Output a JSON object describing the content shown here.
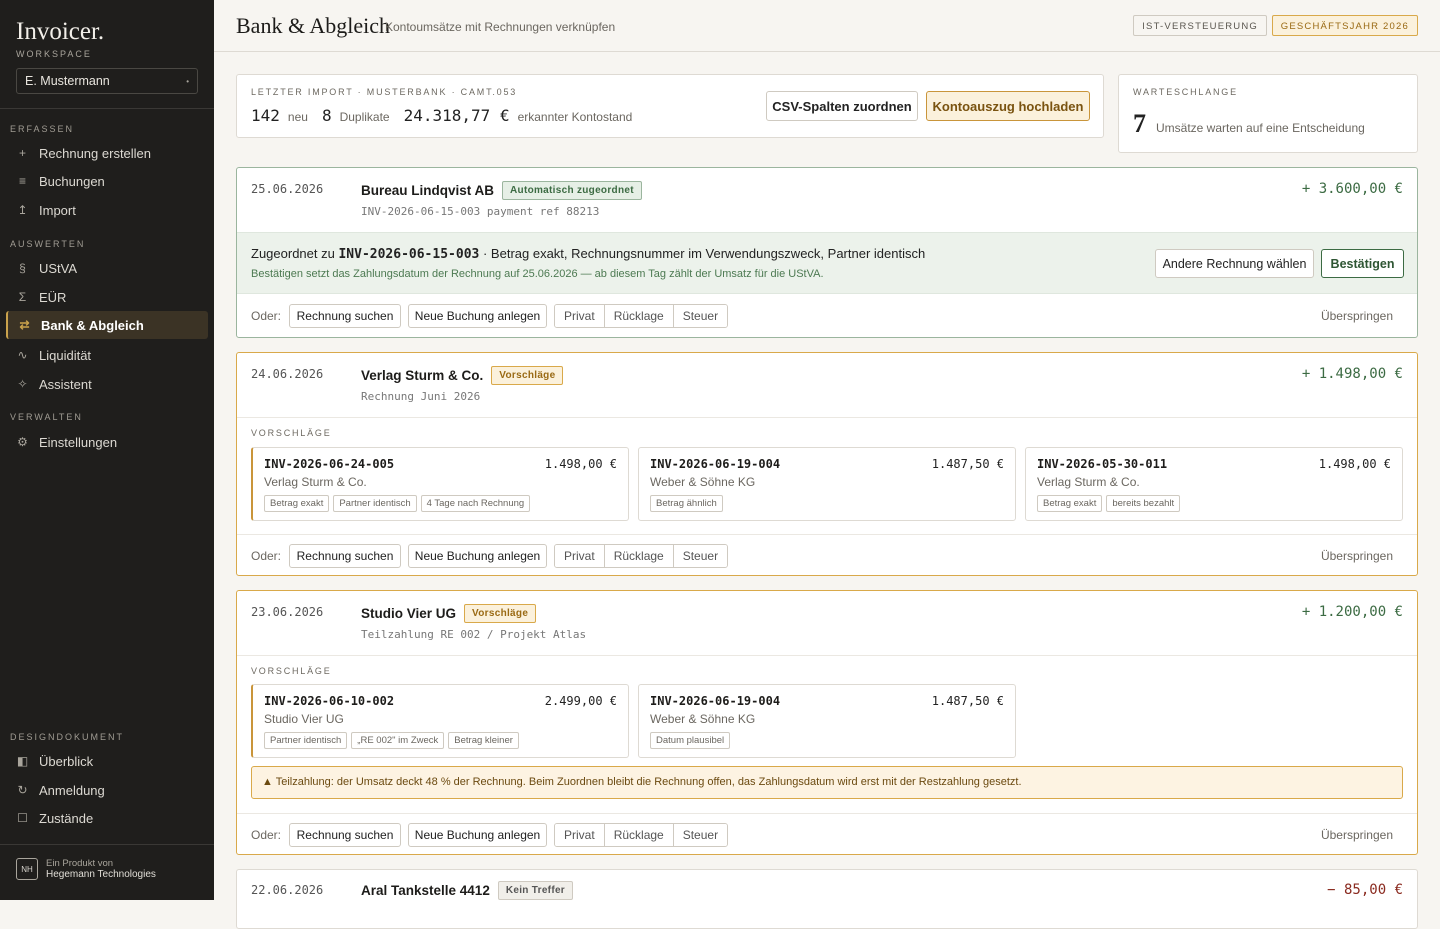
{
  "sidebar": {
    "logo": "Invoicer.",
    "workspace_label": "WORKSPACE",
    "user": "E. Mustermann",
    "sections": [
      {
        "label": "ERFASSEN"
      },
      {
        "label": "AUSWERTEN"
      },
      {
        "label": "VERWALTEN"
      },
      {
        "label": "DESIGNDOKUMENT"
      }
    ],
    "items": [
      {
        "label": "Rechnung erstellen",
        "icon": "plus-icon",
        "glyph": "+"
      },
      {
        "label": "Buchungen",
        "icon": "list-icon",
        "glyph": "≡"
      },
      {
        "label": "Import",
        "icon": "import-icon",
        "glyph": "↥"
      },
      {
        "label": "UStVA",
        "icon": "paragraph-icon",
        "glyph": "§"
      },
      {
        "label": "EÜR",
        "icon": "sigma-icon",
        "glyph": "Σ"
      },
      {
        "label": "Bank & Abgleich",
        "icon": "swap-icon",
        "glyph": "⇄"
      },
      {
        "label": "Liquidität",
        "icon": "trend-icon",
        "glyph": "∿"
      },
      {
        "label": "Assistent",
        "icon": "sparkle-icon",
        "glyph": "✧"
      },
      {
        "label": "Einstellungen",
        "icon": "gear-icon",
        "glyph": "⚙"
      },
      {
        "label": "Überblick",
        "icon": "overview-icon",
        "glyph": "◧"
      },
      {
        "label": "Anmeldung",
        "icon": "login-icon",
        "glyph": "↻"
      },
      {
        "label": "Zustände",
        "icon": "state-icon",
        "glyph": "☐"
      }
    ],
    "brand_line1": "Ein Produkt von",
    "brand_line2": "Hegemann Technologies",
    "brand_mark": "NH"
  },
  "header": {
    "title": "Bank & Abgleich",
    "subtitle": "Kontoumsätze mit Rechnungen verknüpfen",
    "badge_tax": "IST-VERSTEUERUNG",
    "badge_year": "GESCHÄFTSJAHR 2026"
  },
  "import": {
    "label": "LETZTER IMPORT · MUSTERBANK · CAMT.053",
    "new_count": "142",
    "new_label": "neu",
    "dup_count": "8",
    "dup_label": "Duplikate",
    "balance": "24.318,77 €",
    "balance_label": "erkannter Kontostand",
    "btn_csv": "CSV-Spalten zuordnen",
    "btn_upload": "Kontoauszug hochladen"
  },
  "queue": {
    "label": "WARTESCHLANGE",
    "count": "7",
    "text": "Umsätze warten auf eine Entscheidung"
  },
  "common": {
    "oder": "Oder:",
    "search": "Rechnung suchen",
    "new_booking": "Neue Buchung anlegen",
    "privat": "Privat",
    "ruecklage": "Rücklage",
    "steuer": "Steuer",
    "skip": "Überspringen",
    "suggestions_label": "VORSCHLÄGE"
  },
  "transactions": [
    {
      "date": "25.06.2026",
      "name": "Bureau Lindqvist AB",
      "status": "Automatisch zugeordnet",
      "ref": "INV-2026-06-15-003 payment ref 88213",
      "amount": "+ 3.600,00 €",
      "match_prefix": "Zugeordnet zu",
      "match_invoice": "INV-2026-06-15-003",
      "match_reason": "· Betrag exakt, Rechnungsnummer im Verwendungszweck, Partner identisch",
      "match_note": "Bestätigen setzt das Zahlungsdatum der Rechnung auf 25.06.2026 — ab diesem Tag zählt der Umsatz für die UStVA.",
      "btn_other": "Andere Rechnung wählen",
      "btn_confirm": "Bestätigen"
    },
    {
      "date": "24.06.2026",
      "name": "Verlag Sturm & Co.",
      "status": "Vorschläge",
      "ref": "Rechnung Juni 2026",
      "amount": "+ 1.498,00 €",
      "suggestions": [
        {
          "invoice": "INV-2026-06-24-005",
          "amount": "1.498,00 €",
          "partner": "Verlag Sturm & Co.",
          "tags": [
            "Betrag exakt",
            "Partner identisch",
            "4 Tage nach Rechnung"
          ]
        },
        {
          "invoice": "INV-2026-06-19-004",
          "amount": "1.487,50 €",
          "partner": "Weber & Söhne KG",
          "tags": [
            "Betrag ähnlich"
          ]
        },
        {
          "invoice": "INV-2026-05-30-011",
          "amount": "1.498,00 €",
          "partner": "Verlag Sturm & Co.",
          "tags": [
            "Betrag exakt",
            "bereits bezahlt"
          ]
        }
      ]
    },
    {
      "date": "23.06.2026",
      "name": "Studio Vier UG",
      "status": "Vorschläge",
      "ref": "Teilzahlung RE 002 / Projekt Atlas",
      "amount": "+ 1.200,00 €",
      "suggestions": [
        {
          "invoice": "INV-2026-06-10-002",
          "amount": "2.499,00 €",
          "partner": "Studio Vier UG",
          "tags": [
            "Partner identisch",
            "„RE 002\" im Zweck",
            "Betrag kleiner"
          ]
        },
        {
          "invoice": "INV-2026-06-19-004",
          "amount": "1.487,50 €",
          "partner": "Weber & Söhne KG",
          "tags": [
            "Datum plausibel"
          ]
        }
      ],
      "warning": "▲ Teilzahlung: der Umsatz deckt 48 % der Rechnung. Beim Zuordnen bleibt die Rechnung offen, das Zahlungsdatum wird erst mit der Restzahlung gesetzt."
    },
    {
      "date": "22.06.2026",
      "name": "Aral Tankstelle 4412",
      "status": "Kein Treffer",
      "amount": "− 85,00 €"
    }
  ]
}
